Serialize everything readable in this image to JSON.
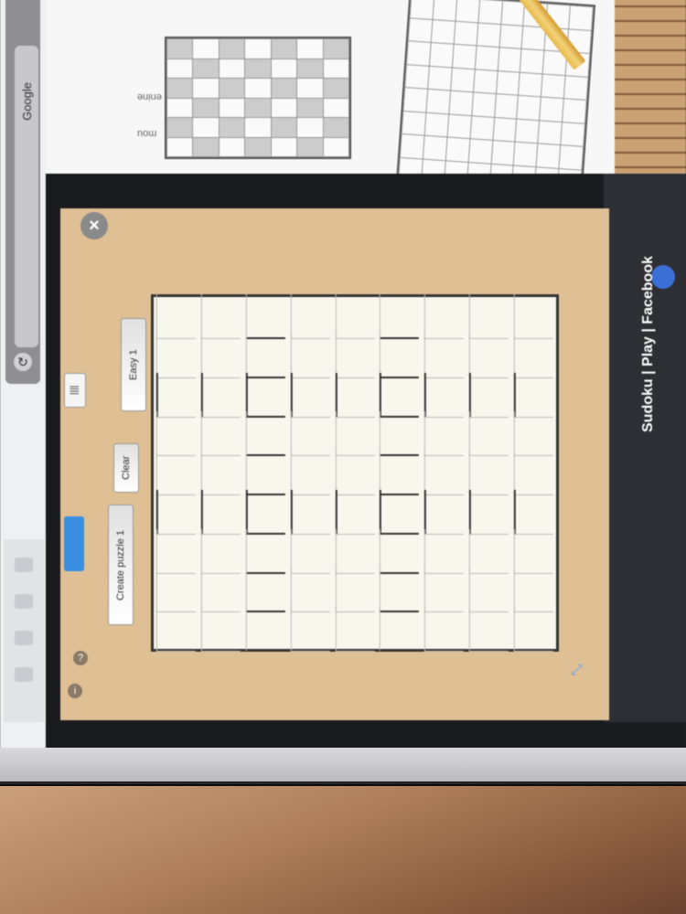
{
  "browser": {
    "address_text": "Google",
    "reload_icon": "reload-icon"
  },
  "background_page": {
    "snippets": [
      "mou",
      "enine"
    ]
  },
  "modal": {
    "title": "Sudoku | Play | Facebook",
    "close_label": "×",
    "buttons": {
      "easy_label": "Easy 1",
      "clear_label": "Clear",
      "new_puzzle_label": "Create puzzle 1",
      "pause_label": "||||"
    }
  },
  "sudoku": {
    "cells": [
      [
        "",
        "",
        "",
        "",
        "",
        "",
        "",
        "",
        ""
      ],
      [
        "",
        "",
        "",
        "",
        "",
        "",
        "",
        "",
        ""
      ],
      [
        "",
        "",
        "",
        "",
        "",
        "",
        "",
        "",
        ""
      ],
      [
        "",
        "",
        "",
        "",
        "",
        "",
        "",
        "",
        ""
      ],
      [
        "",
        "",
        "",
        "",
        "",
        "",
        "",
        "",
        ""
      ],
      [
        "",
        "",
        "",
        "",
        "",
        "",
        "",
        "",
        ""
      ],
      [
        "",
        "",
        "",
        "",
        "",
        "",
        "",
        "",
        ""
      ],
      [
        "",
        "",
        "",
        "",
        "",
        "",
        "",
        "",
        ""
      ],
      [
        "",
        "",
        "",
        "",
        "",
        "",
        "",
        "",
        ""
      ]
    ]
  },
  "colors": {
    "modal_bg": "#dfbf94",
    "board_bg": "#f7f7ee",
    "accent": "#3a8fe0"
  }
}
